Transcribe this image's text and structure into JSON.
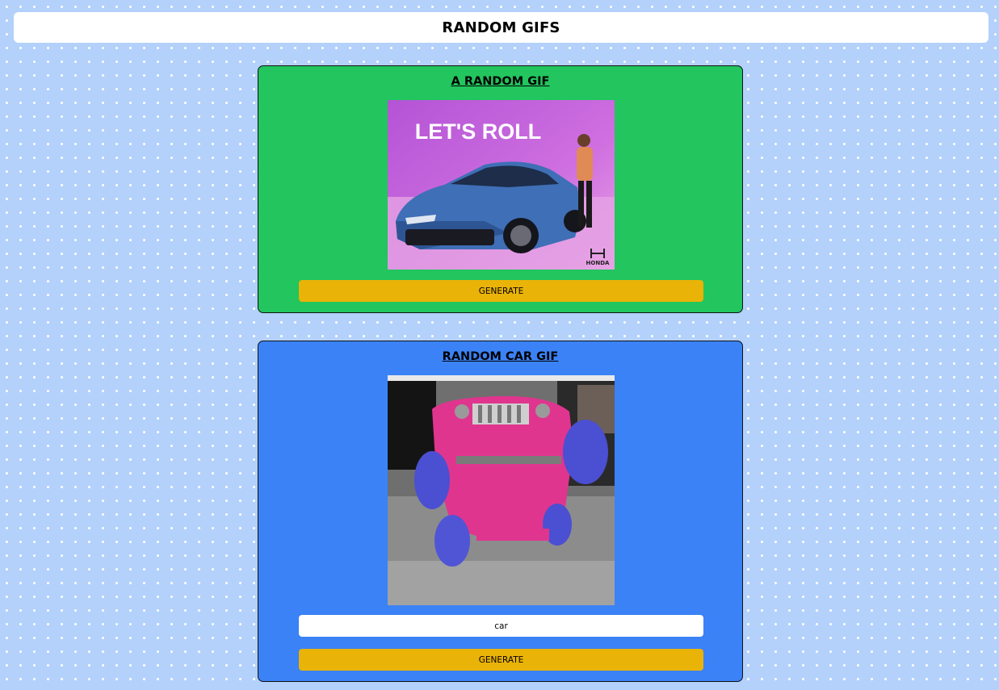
{
  "header": {
    "title": "RANDOM GIFS"
  },
  "random_gif": {
    "title": "A RANDOM GIF",
    "image": {
      "caption": "LET'S ROLL",
      "brand": "HONDA"
    },
    "generate_label": "GENERATE"
  },
  "tag_gif": {
    "title": "RANDOM CAR GIF",
    "input_value": "car",
    "generate_label": "GENERATE"
  },
  "colors": {
    "background": "#b3d1fb",
    "card_green": "#22c55e",
    "card_blue": "#3b82f6",
    "button": "#eab308"
  }
}
